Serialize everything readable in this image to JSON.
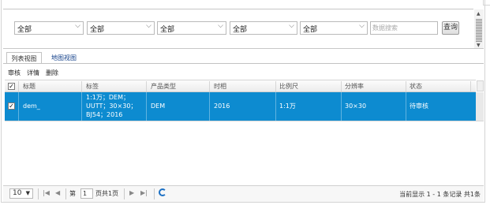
{
  "filters": {
    "selects": [
      "全部",
      "全部",
      "全部",
      "全部",
      "全部"
    ],
    "keyword_placeholder": "数据搜索",
    "query_label": "查询"
  },
  "tabs": [
    {
      "label": "列表视图",
      "active": true
    },
    {
      "label": "地图视图",
      "active": false
    }
  ],
  "toolbar": {
    "review": "审核",
    "detail": "详情",
    "delete": "删除"
  },
  "grid": {
    "columns": [
      "标题",
      "标签",
      "产品类型",
      "时相",
      "比例尺",
      "分辨率",
      "状态"
    ],
    "rows": [
      {
        "checked": true,
        "title": "dem_",
        "tag_lines": [
          "1:1万；DEM；",
          "UUTT；30×30；",
          "BJ54；2016"
        ],
        "product_type": "DEM",
        "phase": "2016",
        "scale": "1:1万",
        "resolution": "30×30",
        "status": "待审核"
      }
    ],
    "selected_row_color": "#0d8bd0"
  },
  "pager": {
    "page_size": "10",
    "page_prefix": "第",
    "page_value": "1",
    "page_suffix": "页共1页",
    "info": "当前显示 1 - 1 条记录 共1条"
  }
}
